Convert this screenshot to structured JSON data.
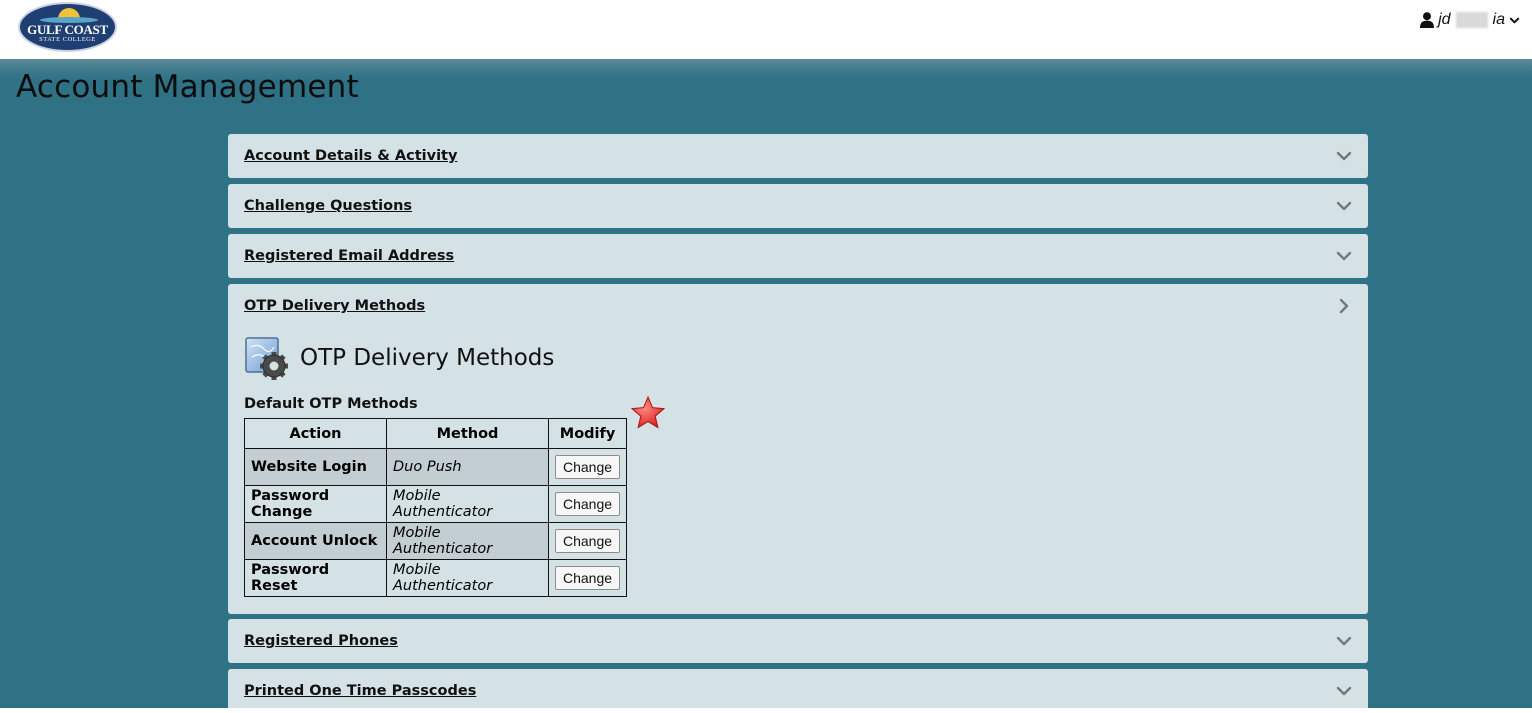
{
  "header": {
    "logo": {
      "line1": "GULF COAST",
      "line2": "STATE COLLEGE"
    },
    "user": {
      "prefix": "jd",
      "suffix": "ia"
    }
  },
  "page": {
    "title": "Account Management"
  },
  "sections": [
    {
      "label": "Account Details & Activity",
      "state": "collapsed",
      "icon": "chevron-down-icon"
    },
    {
      "label": "Challenge Questions",
      "state": "collapsed",
      "icon": "chevron-down-icon"
    },
    {
      "label": "Registered Email Address",
      "state": "collapsed",
      "icon": "chevron-down-icon"
    },
    {
      "label": "OTP Delivery Methods",
      "state": "expanded",
      "icon": "chevron-right-icon"
    },
    {
      "label": "Registered Phones",
      "state": "collapsed",
      "icon": "chevron-down-icon"
    },
    {
      "label": "Printed One Time Passcodes",
      "state": "collapsed",
      "icon": "chevron-down-icon"
    }
  ],
  "otp": {
    "title": "OTP Delivery Methods",
    "subtitle": "Default OTP Methods",
    "columns": [
      "Action",
      "Method",
      "Modify"
    ],
    "rows": [
      {
        "action": "Website Login",
        "method": "Duo Push",
        "button": "Change"
      },
      {
        "action": "Password Change",
        "method": "Mobile Authenticator",
        "button": "Change"
      },
      {
        "action": "Account Unlock",
        "method": "Mobile Authenticator",
        "button": "Change"
      },
      {
        "action": "Password Reset",
        "method": "Mobile Authenticator",
        "button": "Change"
      }
    ]
  },
  "colors": {
    "background": "#2f7185",
    "panel": "#d5e2e5",
    "row_shade": "#c2ced1",
    "star": "#e8322f"
  }
}
